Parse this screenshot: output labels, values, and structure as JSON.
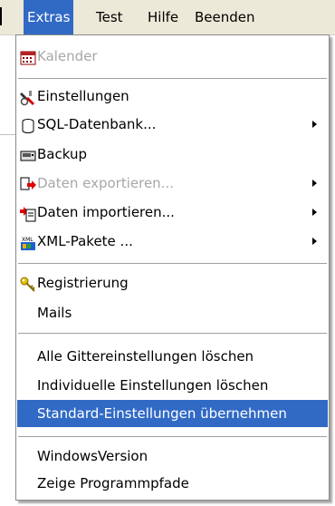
{
  "menubar": {
    "items": [
      {
        "label": "Extras"
      },
      {
        "label": "Test"
      },
      {
        "label": "Hilfe"
      },
      {
        "label": "Beenden"
      }
    ]
  },
  "menu": {
    "items": [
      {
        "label": "Kalender",
        "icon": "calendar-icon",
        "disabled": true
      },
      {
        "label": "Einstellungen",
        "icon": "settings-tools-icon"
      },
      {
        "label": "SQL-Datenbank...",
        "icon": "database-icon",
        "submenu": true
      },
      {
        "label": "Backup",
        "icon": "backup-drive-icon"
      },
      {
        "label": "Daten exportieren...",
        "icon": "export-icon",
        "submenu": true,
        "disabled": true
      },
      {
        "label": "Daten importieren...",
        "icon": "import-icon",
        "submenu": true
      },
      {
        "label": "XML-Pakete ...",
        "icon": "xml-package-icon",
        "submenu": true
      },
      {
        "label": "Registrierung",
        "icon": "key-icon"
      },
      {
        "label": "Mails"
      },
      {
        "label": "Alle Gittereinstellungen löschen"
      },
      {
        "label": "Individuelle Einstellungen löschen"
      },
      {
        "label": "Standard-Einstellungen übernehmen",
        "selected": true
      },
      {
        "label": "WindowsVersion"
      },
      {
        "label": "Zeige Programmpfade"
      }
    ]
  },
  "colors": {
    "selection": "#316ac5",
    "menubar_bg": "#ece9d8",
    "disabled_text": "#a7a7a7"
  }
}
